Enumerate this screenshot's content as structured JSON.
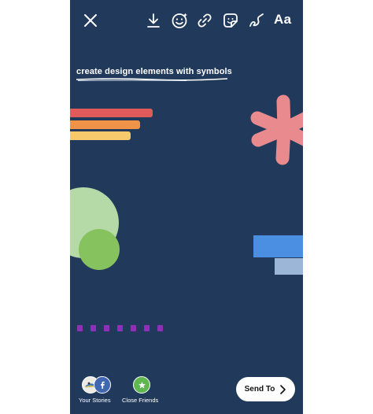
{
  "toolbar": {
    "icons": [
      "close-icon",
      "download-icon",
      "face-effects-icon",
      "link-icon",
      "sticker-icon",
      "draw-icon"
    ],
    "text_tool_label": "Aa"
  },
  "caption": {
    "text": "create design elements with symbols"
  },
  "colors": {
    "background": "#213a5c",
    "bar_red": "#e05a5b",
    "bar_orange": "#ef9349",
    "bar_yellow": "#f6c96c",
    "asterisk": "#e88a8e",
    "circle_light": "#b5d9a7",
    "circle_green": "#86c25d",
    "rect_blue": "#4a8fe2",
    "rect_light_blue": "#9cb6d8",
    "dots_purple": "#8f31b8",
    "send_button": "#ffffff"
  },
  "bottom": {
    "your_stories_label": "Your Stories",
    "close_friends_label": "Close Friends",
    "send_label": "Send To"
  }
}
